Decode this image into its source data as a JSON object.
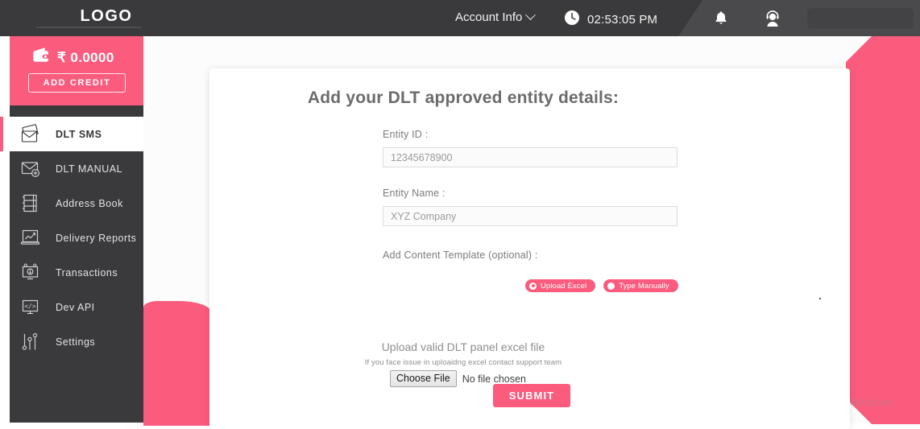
{
  "header": {
    "logo": "LOGO",
    "account_label": "Account Info",
    "time": "02:53:05 PM",
    "icons": {
      "chevron": "chevron-down-icon",
      "clock": "clock-icon",
      "bell": "bell-icon",
      "avatar": "support-agent-icon"
    }
  },
  "sidebar": {
    "wallet": {
      "balance": "₹ 0.0000",
      "add_credit_label": "ADD CREDIT"
    },
    "items": [
      {
        "label": "DLT SMS",
        "icon": "envelope-stack-icon",
        "active": true
      },
      {
        "label": "DLT MANUAL",
        "icon": "envelope-plus-icon",
        "active": false
      },
      {
        "label": "Address Book",
        "icon": "address-book-icon",
        "active": false
      },
      {
        "label": "Delivery Reports",
        "icon": "chart-laptop-icon",
        "active": false
      },
      {
        "label": "Transactions",
        "icon": "monitor-coin-icon",
        "active": false
      },
      {
        "label": "Dev API",
        "icon": "code-monitor-icon",
        "active": false
      },
      {
        "label": "Settings",
        "icon": "sliders-icon",
        "active": false
      }
    ]
  },
  "main": {
    "title": "Add your DLT approved entity details:",
    "entity_id": {
      "label": "Entity ID :",
      "value": "",
      "placeholder": "12345678900"
    },
    "entity_name": {
      "label": "Entity Name :",
      "value": "",
      "placeholder": "XYZ Company"
    },
    "content_template": {
      "label": "Add Content Template (optional) :",
      "options": [
        {
          "label": "Upload Excel",
          "selected": true
        },
        {
          "label": "Type Manually",
          "selected": false
        }
      ]
    },
    "file_upload": {
      "button_label": "Choose File",
      "status": "No file chosen"
    },
    "hint_main": "Upload valid DLT panel excel file",
    "hint_sub": "If you face issue in uploaidng excel contact support team",
    "submit_label": "SUBMIT"
  },
  "watermark": "Windows",
  "colors": {
    "accent_pink": "#fb5b7d",
    "dark_nav": "#3a3a3c",
    "header_light": "#4a4a4c"
  }
}
